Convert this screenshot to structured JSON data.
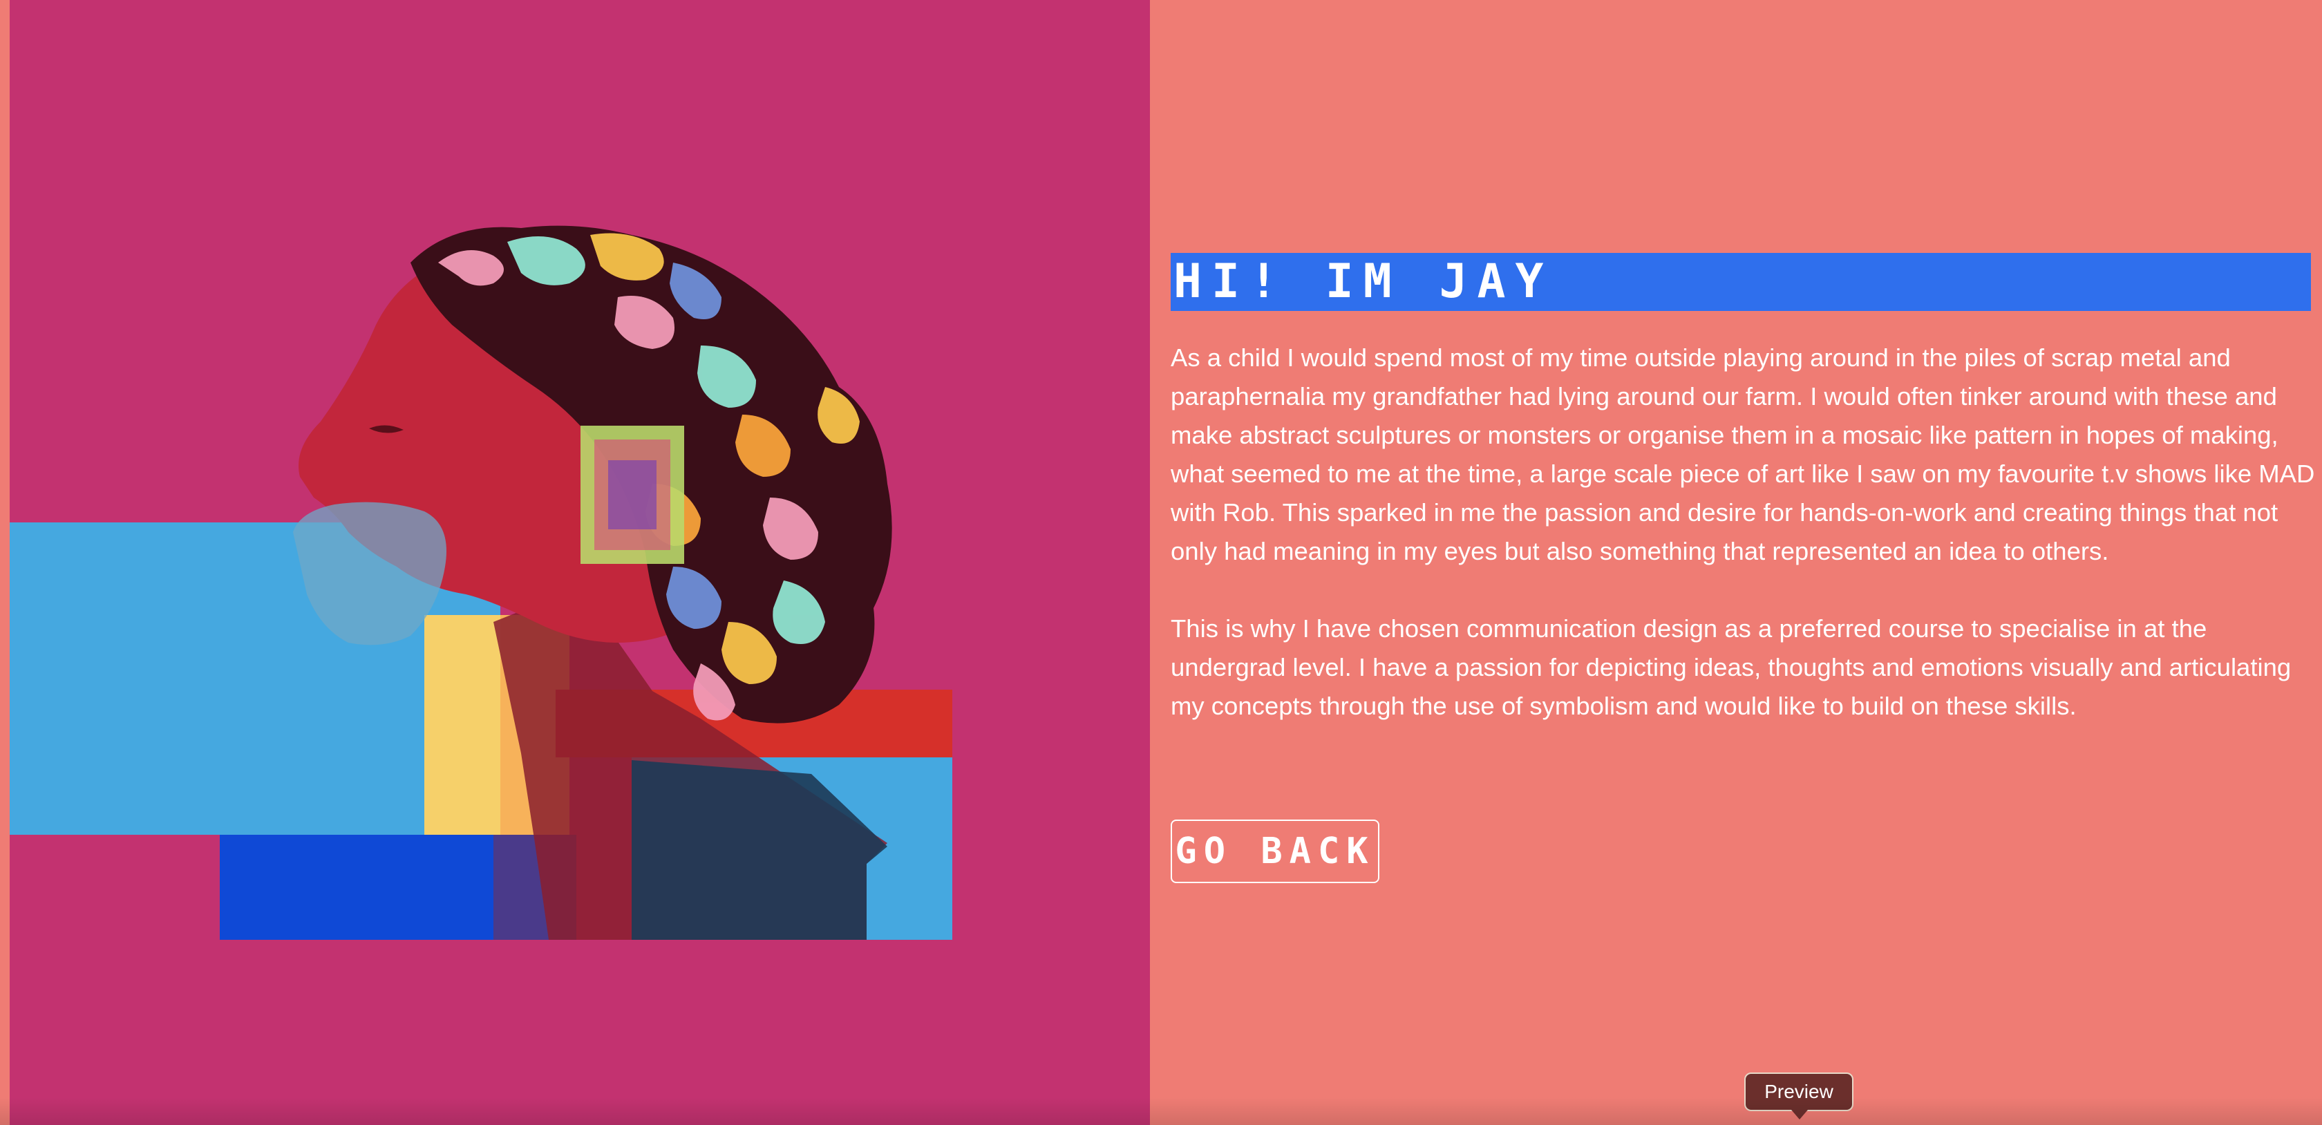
{
  "header": {
    "title": "HI! IM JAY"
  },
  "bio": {
    "paragraphs": [
      "As a child I would spend most of my time outside playing around in the piles of scrap metal and paraphernalia my grandfather had lying around our farm. I would often tinker around with these and make abstract sculptures or monsters or organise them in a mosaic like pattern in hopes of making, what seemed to me at the time, a large scale piece of art like I saw on my favourite t.v shows like MAD with Rob. This sparked in me the passion and desire for hands-on-work and creating things that not only had meaning in my eyes but also something that represented an idea to others.",
      "This is why I have chosen communication design as a preferred course to specialise in at the undergrad level. I have a passion for depicting ideas, thoughts and emotions visually and articulating my concepts through the use of symbolism and would like to build on these skills."
    ]
  },
  "actions": {
    "back_label": "GO BACK"
  },
  "tooltip": {
    "label": "Preview"
  },
  "colors": {
    "left_background": "#c33270",
    "right_background": "#ef7c74",
    "title_highlight": "#2f6fed"
  }
}
